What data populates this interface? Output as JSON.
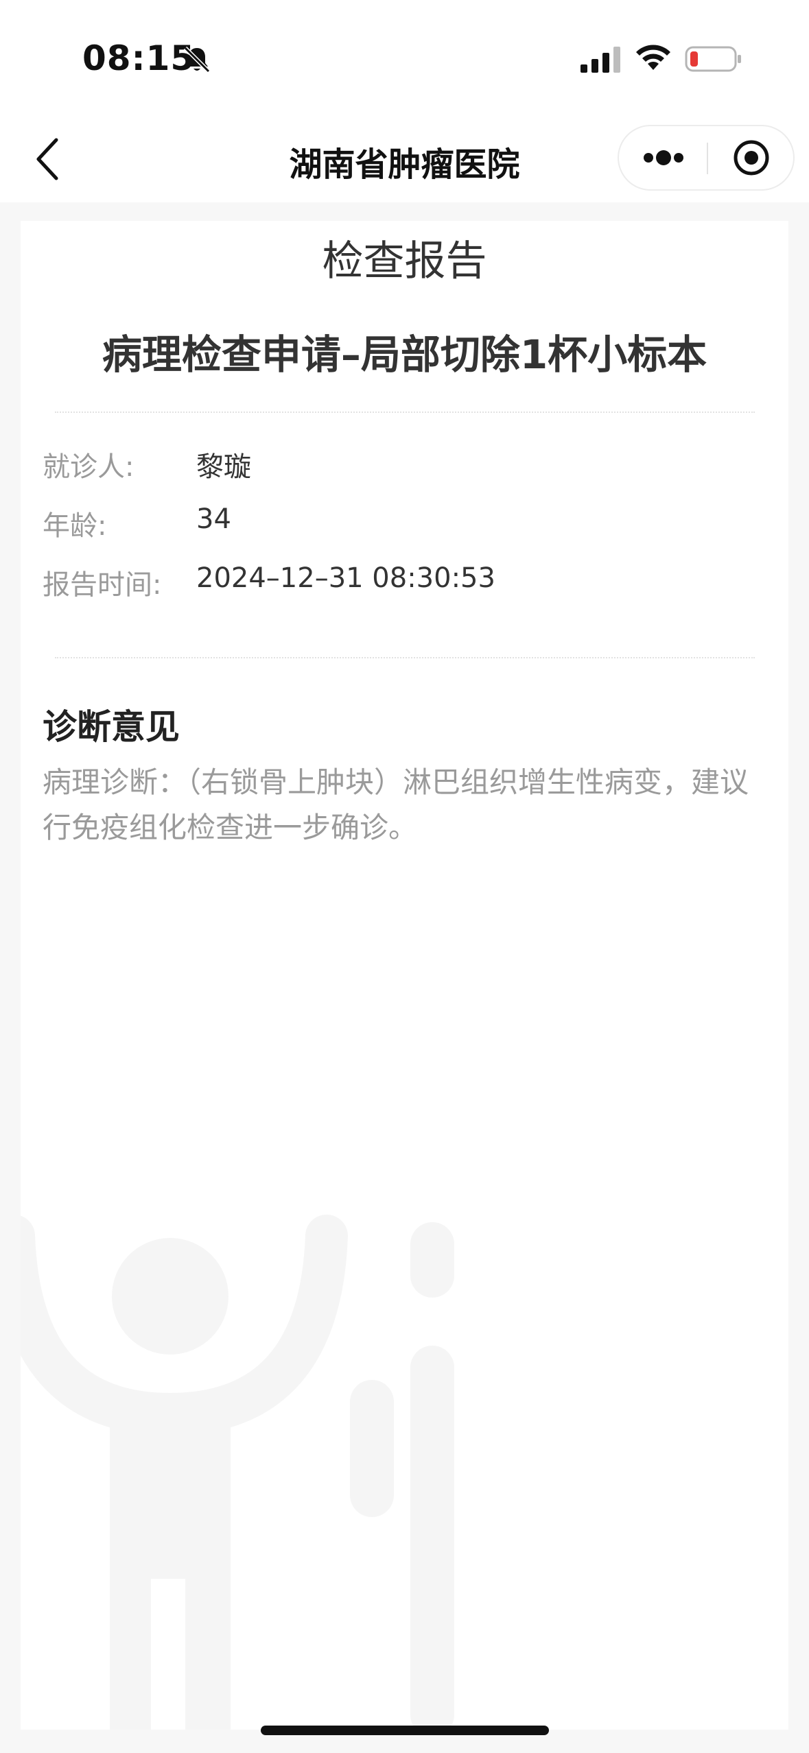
{
  "status_bar": {
    "time": "08:15",
    "icons": [
      "bell-off-icon",
      "cellular-signal-icon",
      "wifi-icon",
      "battery-low-icon"
    ],
    "battery_color": "#e53935"
  },
  "nav": {
    "title": "湖南省肿瘤医院",
    "back_icon": "chevron-left-icon",
    "more_icon": "more-dots-icon",
    "close_icon": "target-close-icon"
  },
  "report": {
    "header": "检查报告",
    "title": "病理检查申请–局部切除1杯小标本",
    "fields": [
      {
        "label": "就诊人:",
        "value": "黎璇"
      },
      {
        "label": "年龄:",
        "value": "34"
      },
      {
        "label": "报告时间:",
        "value": "2024–12–31 08:30:53"
      }
    ],
    "diagnosis": {
      "heading": "诊断意见",
      "text": "病理诊断：（右锁骨上肿块）淋巴组织增生性病变，建议行免疫组化检查进一步确诊。"
    }
  },
  "colors": {
    "page_background": "#f7f7f7",
    "card_background": "#ffffff",
    "label_gray": "#9a9a9a",
    "text_dark": "#333333"
  }
}
